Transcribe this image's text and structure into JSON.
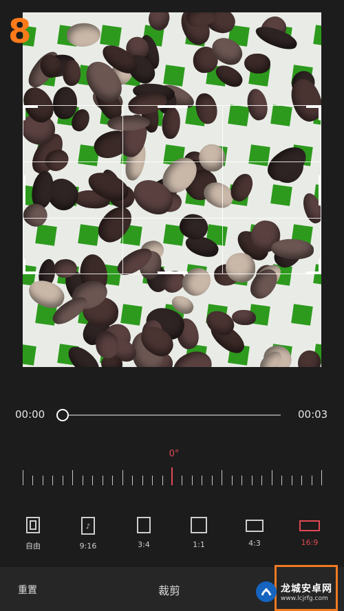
{
  "step_marker": "8",
  "timeline": {
    "start_time": "00:00",
    "end_time": "00:03",
    "progress": 0.0
  },
  "rotation": {
    "angle_label": "0°",
    "angle": 0
  },
  "ratios": [
    {
      "label": "自由",
      "icon": "free-crop-icon"
    },
    {
      "label": "9:16",
      "icon": "tiktok-ratio-icon"
    },
    {
      "label": "3:4",
      "icon": "ratio-3-4-icon"
    },
    {
      "label": "1:1",
      "icon": "ratio-1-1-icon"
    },
    {
      "label": "4:3",
      "icon": "ratio-4-3-icon"
    },
    {
      "label": "16:9",
      "icon": "ratio-16-9-icon",
      "selected": true
    }
  ],
  "bottom_bar": {
    "reset_label": "重置",
    "title": "裁剪"
  },
  "watermark": {
    "name": "龙城安卓网",
    "url": "www.lcjrfg.com"
  },
  "colors": {
    "accent": "#e14a52",
    "highlight": "#f07a22",
    "tile_green": "#2d9a1e"
  }
}
